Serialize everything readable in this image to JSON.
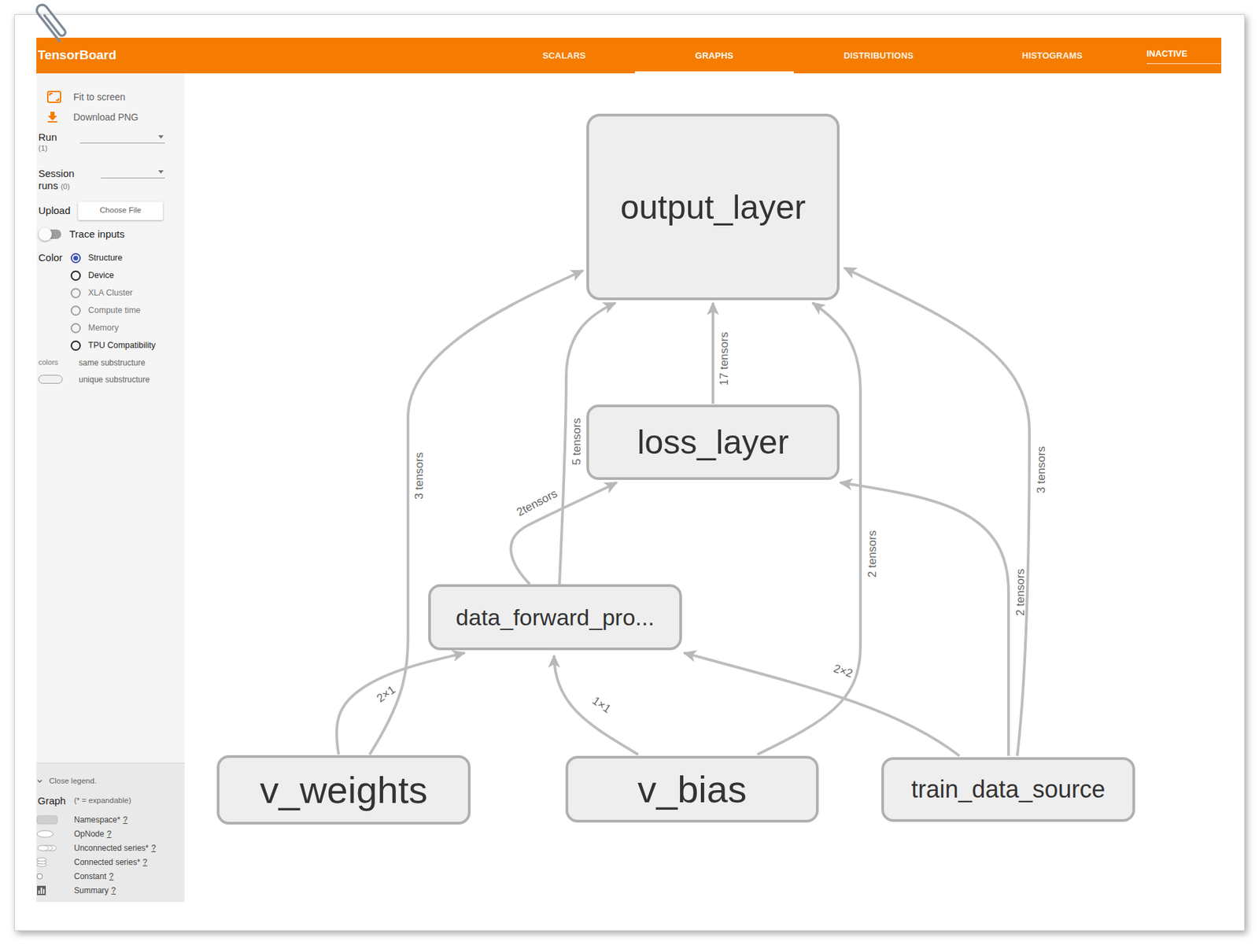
{
  "app": {
    "title": "TensorBoard"
  },
  "tabs": [
    {
      "label": "SCALARS",
      "selected": false
    },
    {
      "label": "GRAPHS",
      "selected": true
    },
    {
      "label": "DISTRIBUTIONS",
      "selected": false
    },
    {
      "label": "HISTOGRAMS",
      "selected": false
    }
  ],
  "inactive_menu": {
    "label": "INACTIVE"
  },
  "sidebar": {
    "actions": [
      {
        "label": "Fit to screen"
      },
      {
        "label": "Download PNG"
      }
    ],
    "run": {
      "label": "Run",
      "count": "(1)"
    },
    "session_runs": {
      "label": "Session runs",
      "count": "(0)"
    },
    "upload": {
      "label": "Upload",
      "button": "Choose File"
    },
    "trace_inputs": {
      "label": "Trace inputs",
      "on": false
    },
    "color": {
      "label": "Color",
      "options": [
        {
          "label": "Structure",
          "selected": true,
          "disabled": false
        },
        {
          "label": "Device",
          "selected": false,
          "disabled": false
        },
        {
          "label": "XLA Cluster",
          "selected": false,
          "disabled": true
        },
        {
          "label": "Compute time",
          "selected": false,
          "disabled": true
        },
        {
          "label": "Memory",
          "selected": false,
          "disabled": true
        },
        {
          "label": "TPU Compatibility",
          "selected": false,
          "disabled": false
        }
      ]
    },
    "color_legend": {
      "label": "colors",
      "items": [
        {
          "label": "same substructure",
          "kind": "same"
        },
        {
          "label": "unique substructure",
          "kind": "unique"
        }
      ]
    },
    "legend": {
      "toggle": "Close legend.",
      "expanded": true,
      "title": "Graph",
      "note": "(* = expandable)",
      "items": [
        {
          "label": "Namespace*",
          "help": "?",
          "kind": "namespace"
        },
        {
          "label": "OpNode",
          "help": "?",
          "kind": "opnode"
        },
        {
          "label": "Unconnected series*",
          "help": "?",
          "kind": "unconnected"
        },
        {
          "label": "Connected series*",
          "help": "?",
          "kind": "connected"
        },
        {
          "label": "Constant",
          "help": "?",
          "kind": "constant"
        },
        {
          "label": "Summary",
          "help": "?",
          "kind": "summary"
        }
      ]
    }
  },
  "graph": {
    "nodes": [
      {
        "name": "output_layer"
      },
      {
        "name": "loss_layer"
      },
      {
        "name": "data_forward_pro..."
      },
      {
        "name": "v_weights"
      },
      {
        "name": "v_bias"
      },
      {
        "name": "train_data_source"
      }
    ],
    "edges": [
      {
        "label": "3 tensors"
      },
      {
        "label": "5 tensors"
      },
      {
        "label": "17 tensors"
      },
      {
        "label": "2 tensors"
      },
      {
        "label": "3 tensors"
      },
      {
        "label": "2tensors"
      },
      {
        "label": "2 tensors"
      },
      {
        "label": "2×1"
      },
      {
        "label": "1×1"
      },
      {
        "label": "2×2"
      }
    ]
  }
}
